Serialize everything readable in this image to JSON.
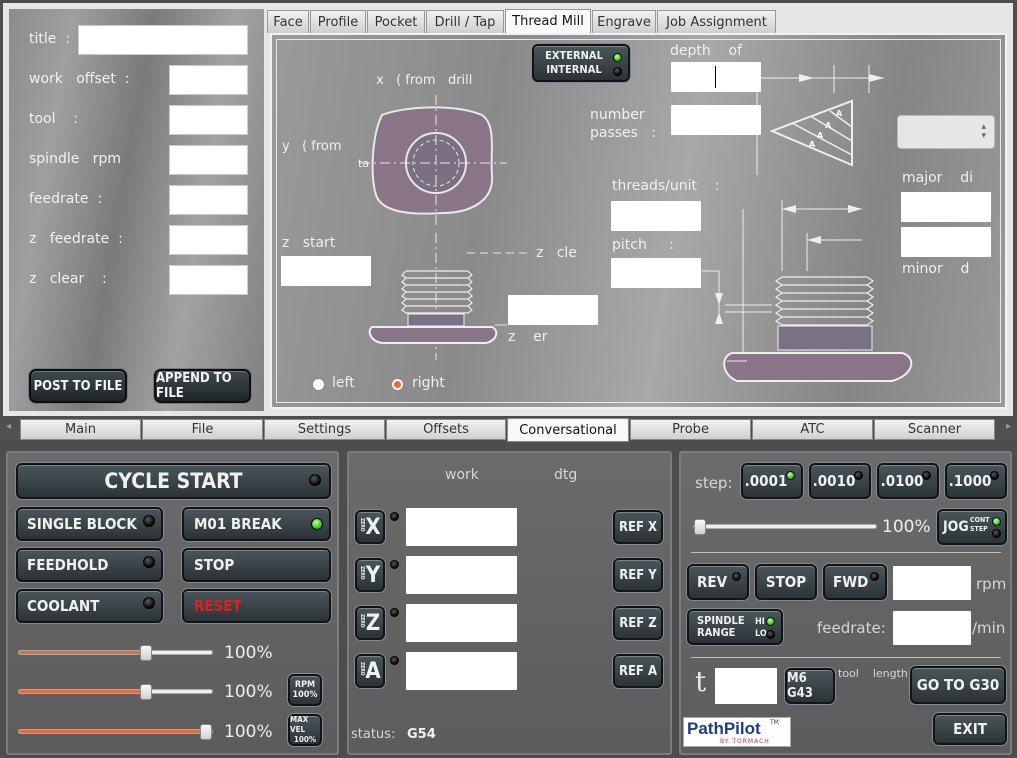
{
  "form": {
    "title_label": "title  :",
    "work_offset_label": "work   offset  :",
    "tool_label": "tool    :",
    "spindle_rpm_label": "spindle   rpm",
    "feedrate_label": "feedrate  :",
    "z_feedrate_label": "z   feedrate  :",
    "z_clear_label": "z   clear    :",
    "post_button": "POST TO FILE",
    "append_button": "APPEND TO FILE"
  },
  "top_tabs": [
    {
      "label": "Face"
    },
    {
      "label": "Profile"
    },
    {
      "label": "Pocket"
    },
    {
      "label": "Drill / Tap"
    },
    {
      "label": "Thread Mill"
    },
    {
      "label": "Engrave"
    },
    {
      "label": "Job Assignment"
    }
  ],
  "drawing": {
    "ext_int_line1": "EXTERNAL",
    "ext_int_line2": "INTERNAL",
    "x_label": "x   ( from   drill",
    "y_label": "y   ( from",
    "ta_label": "ta",
    "depth_label": "depth    of",
    "number_passes_line1": "number",
    "number_passes_line2": "passes   :",
    "threads_unit_label": "threads/unit    :",
    "pitch_label": "pitch     :",
    "major_label": "major    di",
    "minor_label": "minor    d",
    "z_start_label": "z   start",
    "z_clear_label": "z   cle",
    "z_er_label": "z    er",
    "left_label": "left",
    "right_label": "right",
    "thread_marks": [
      "A",
      "A",
      "A",
      "A"
    ]
  },
  "bottom_tabs": [
    {
      "label": "Main"
    },
    {
      "label": "File"
    },
    {
      "label": "Settings"
    },
    {
      "label": "Offsets"
    },
    {
      "label": "Conversational"
    },
    {
      "label": "Probe"
    },
    {
      "label": "ATC"
    },
    {
      "label": "Scanner"
    }
  ],
  "controls": {
    "cycle_start": "CYCLE START",
    "single_block": "SINGLE BLOCK",
    "m01_break": "M01 BREAK",
    "feedhold": "FEEDHOLD",
    "stop": "STOP",
    "coolant": "COOLANT",
    "reset": "RESET",
    "sliders": [
      {
        "pct_label": "100%",
        "level": 0.66
      },
      {
        "pct_label": "100%",
        "level": 0.66
      },
      {
        "pct_label": "100%",
        "level": 0.98
      }
    ],
    "rpm_btn_l1": "RPM",
    "rpm_btn_l2": "100%",
    "maxvel_btn_l1": "MAX VEL",
    "maxvel_btn_l2": "100%"
  },
  "dro": {
    "work_header": "work",
    "dtg_header": "dtg",
    "zero_label": "ZERO",
    "axes": [
      {
        "axis": "X",
        "ref": "REF X"
      },
      {
        "axis": "Y",
        "ref": "REF Y"
      },
      {
        "axis": "Z",
        "ref": "REF Z"
      },
      {
        "axis": "A",
        "ref": "REF A"
      }
    ],
    "status_label": "status:",
    "status_value": "G54"
  },
  "jog": {
    "step_label": "step:",
    "steps": [
      {
        "label": ".0001",
        "active": true
      },
      {
        "label": ".0010",
        "active": false
      },
      {
        "label": ".0100",
        "active": false
      },
      {
        "label": ".1000",
        "active": false
      }
    ],
    "jog_pct": "100%",
    "jog_level": 0.0,
    "jog_btn": "JOG",
    "cont_label": "CONT",
    "step_mode_label": "STEP",
    "rev": "REV",
    "stop": "STOP",
    "fwd": "FWD",
    "rpm_unit": "rpm",
    "spindle_l1": "SPINDLE",
    "spindle_l2": "RANGE",
    "hi": "HI",
    "lo": "LO",
    "feedrate_label": "feedrate:",
    "feed_unit": "/min",
    "t_label": "t",
    "m6g43": "M6 G43",
    "tool_length_label": "tool    length",
    "go_to_g30": "GO TO G30",
    "exit": "EXIT",
    "logo_main": "PathPilot",
    "logo_sub": "BY TORMACH",
    "logo_tm": "TM"
  },
  "colors": {
    "accent_orange": "#e86c3a",
    "led_green": "#3ad21f",
    "reset_red": "#e02020",
    "part_purple": "#8a7488"
  }
}
